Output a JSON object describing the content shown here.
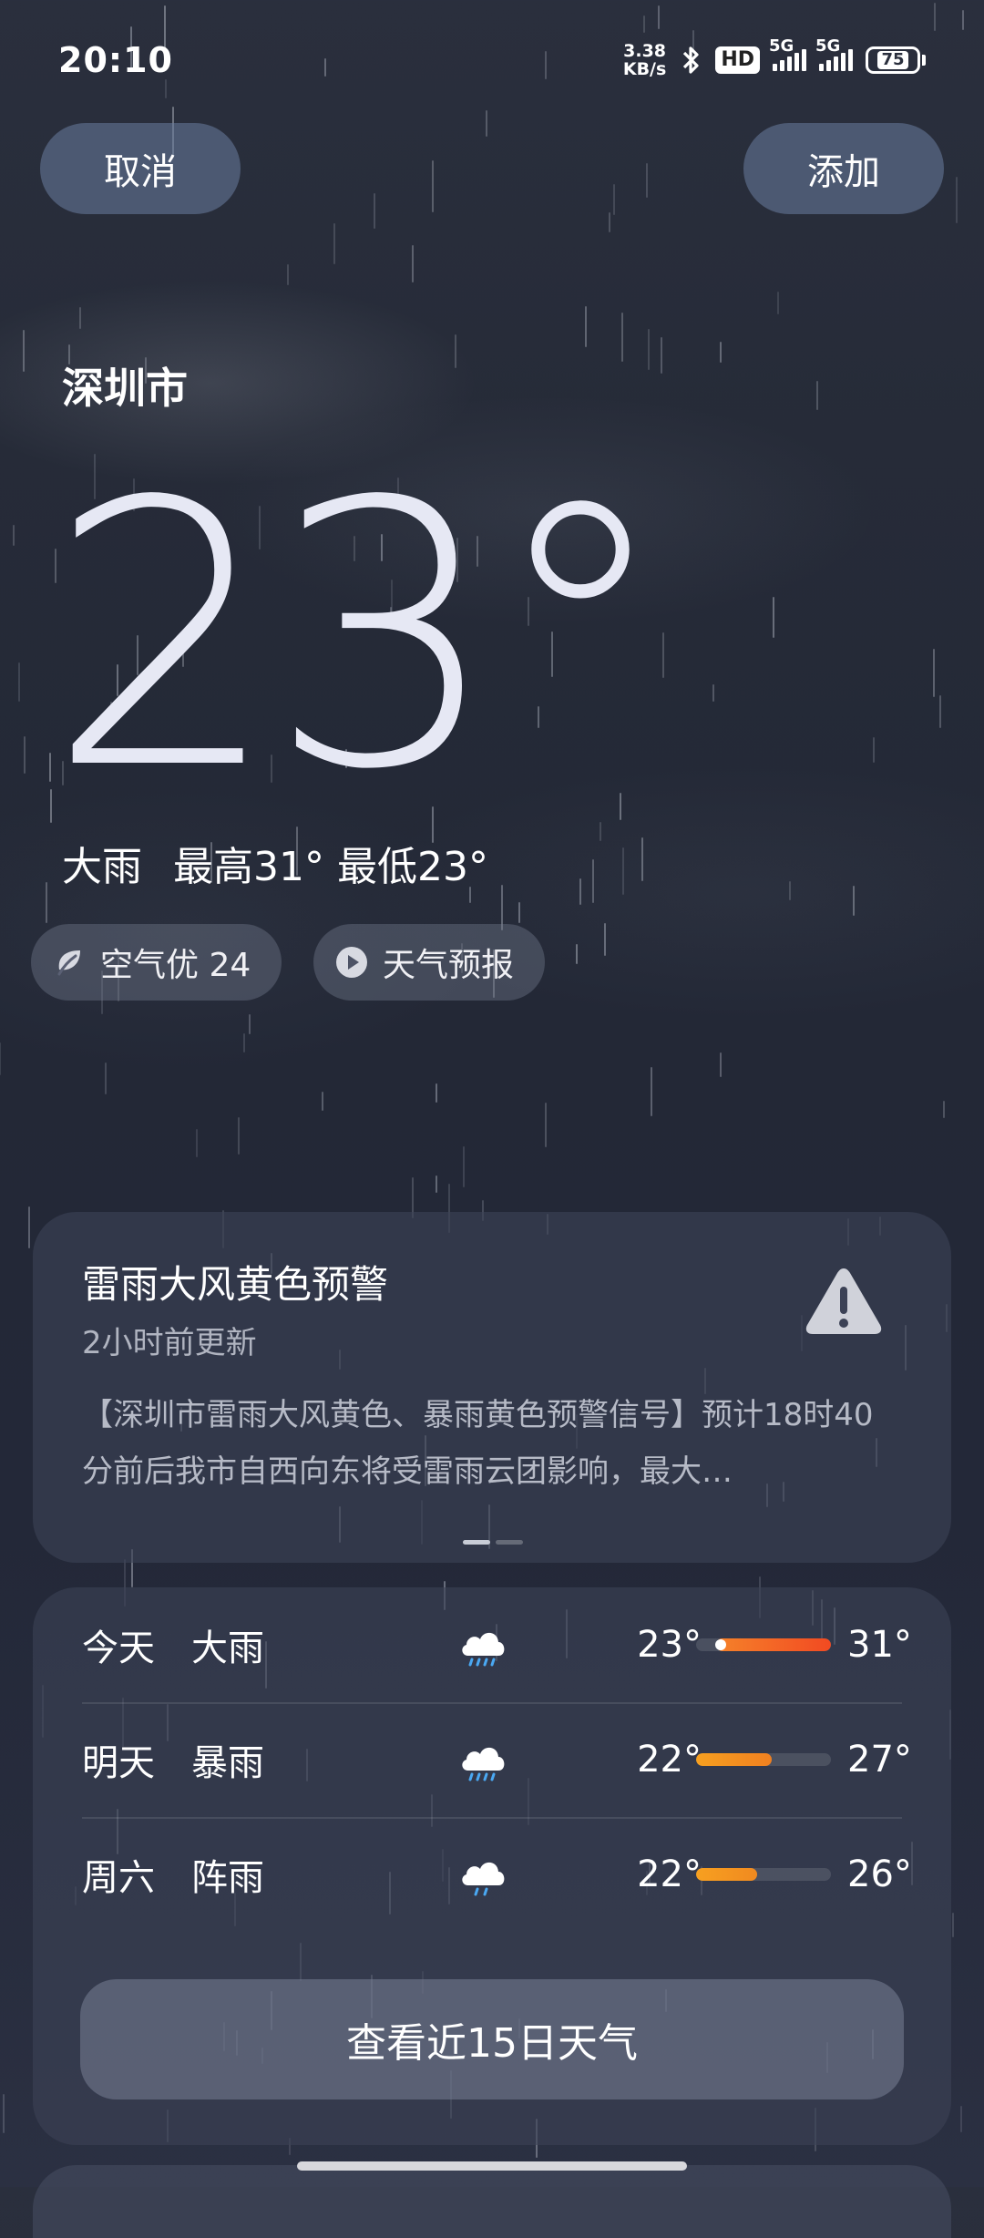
{
  "status_bar": {
    "time": "20:10",
    "net_speed_value": "3.38",
    "net_speed_unit": "KB/s",
    "hd_badge": "HD",
    "network1": "5G",
    "network2": "5G",
    "battery": "75"
  },
  "top_bar": {
    "cancel_label": "取消",
    "add_label": "添加"
  },
  "current": {
    "city": "深圳市",
    "temperature": "23°",
    "condition": "大雨",
    "high": "最高31°",
    "low": "最低23°"
  },
  "chips": {
    "air_quality": "空气优 24",
    "forecast_video": "天气预报"
  },
  "alert": {
    "title": "雷雨大风黄色预警",
    "updated": "2小时前更新",
    "description": "【深圳市雷雨大风黄色、暴雨黄色预警信号】预计18时40分前后我市自西向东将受雷雨云团影响，最大…",
    "icon": "warning-triangle-icon"
  },
  "forecast": {
    "days": [
      {
        "day": "今天",
        "condition": "大雨",
        "icon": "heavy-rain-icon",
        "low": "23°",
        "high": "31°",
        "range_start": 0.15,
        "range_end": 1.0,
        "current_marker": 0.18,
        "color_start": "#f5822a",
        "color_end": "#f24a22"
      },
      {
        "day": "明天",
        "condition": "暴雨",
        "icon": "heavy-rain-icon",
        "low": "22°",
        "high": "27°",
        "range_start": 0.0,
        "range_end": 0.56,
        "color_start": "#f7a020",
        "color_end": "#f08020"
      },
      {
        "day": "周六",
        "condition": "阵雨",
        "icon": "shower-icon",
        "low": "22°",
        "high": "26°",
        "range_start": 0.0,
        "range_end": 0.45,
        "color_start": "#f7a020",
        "color_end": "#f08a20"
      }
    ],
    "view_15_days": "查看近15日天气"
  }
}
